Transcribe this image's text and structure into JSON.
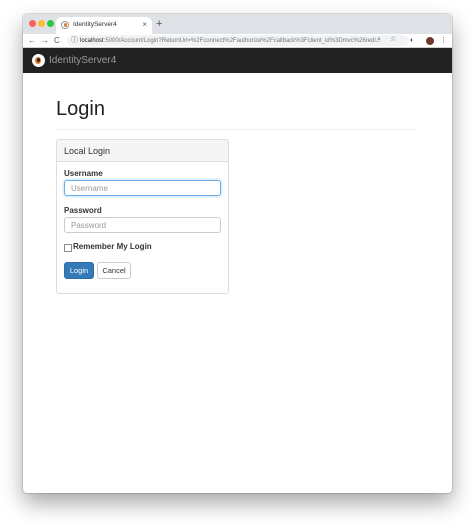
{
  "browser": {
    "tab_title": "IdentityServer4",
    "tab_close": "×",
    "new_tab": "+",
    "url_host": "localhost",
    "url_rest": ":5000/Account/Login?ReturnUrl=%2Fconnect%2Fauthorize%2Fcallback%3Fclient_id%3Dmvc%26redi...",
    "back": "←",
    "forward": "→",
    "reload": "C"
  },
  "navbar": {
    "brand": "IdentityServer4"
  },
  "page": {
    "title": "Login"
  },
  "panel": {
    "title": "Local Login"
  },
  "form": {
    "username_label": "Username",
    "username_placeholder": "Username",
    "password_label": "Password",
    "password_placeholder": "Password",
    "remember_label": "Remember My Login",
    "login_button": "Login",
    "cancel_button": "Cancel"
  },
  "colors": {
    "navbar": "#222222",
    "primary": "#337ab7"
  }
}
